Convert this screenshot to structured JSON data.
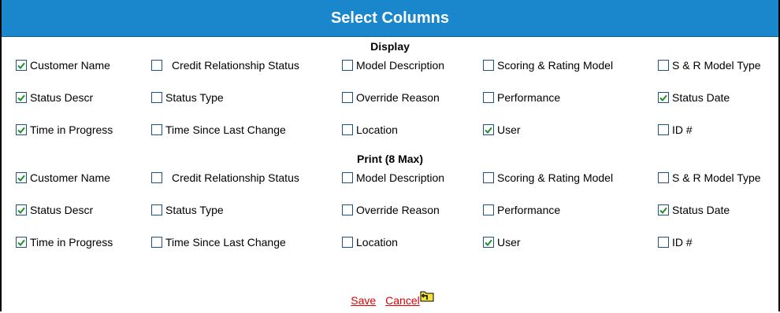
{
  "title": "Select Columns",
  "colors": {
    "title_bg": "#1a87cc",
    "link": "#e00000",
    "check": "#1f8f2a"
  },
  "display": {
    "heading": "Display",
    "rows": [
      [
        {
          "label": "Customer Name",
          "checked": true
        },
        {
          "label": "Credit Relationship Status",
          "checked": false
        },
        {
          "label": "Model Description",
          "checked": false
        },
        {
          "label": "Scoring & Rating Model",
          "checked": false
        },
        {
          "label": "S & R Model Type",
          "checked": false
        }
      ],
      [
        {
          "label": "Status Descr",
          "checked": true
        },
        {
          "label": "Status Type",
          "checked": false
        },
        {
          "label": "Override Reason",
          "checked": false
        },
        {
          "label": "Performance",
          "checked": false
        },
        {
          "label": "Status Date",
          "checked": true
        }
      ],
      [
        {
          "label": "Time in Progress",
          "checked": true
        },
        {
          "label": "Time Since Last Change",
          "checked": false
        },
        {
          "label": "Location",
          "checked": false
        },
        {
          "label": "User",
          "checked": true
        },
        {
          "label": "ID #",
          "checked": false
        }
      ]
    ]
  },
  "print": {
    "heading": "Print (8 Max)",
    "rows": [
      [
        {
          "label": "Customer Name",
          "checked": true
        },
        {
          "label": "Credit Relationship Status",
          "checked": false
        },
        {
          "label": "Model Description",
          "checked": false
        },
        {
          "label": "Scoring & Rating Model",
          "checked": false
        },
        {
          "label": "S & R Model Type",
          "checked": false
        }
      ],
      [
        {
          "label": "Status Descr",
          "checked": true
        },
        {
          "label": "Status Type",
          "checked": false
        },
        {
          "label": "Override Reason",
          "checked": false
        },
        {
          "label": "Performance",
          "checked": false
        },
        {
          "label": "Status Date",
          "checked": true
        }
      ],
      [
        {
          "label": "Time in Progress",
          "checked": true
        },
        {
          "label": "Time Since Last Change",
          "checked": false
        },
        {
          "label": "Location",
          "checked": false
        },
        {
          "label": "User",
          "checked": true
        },
        {
          "label": "ID #",
          "checked": false
        }
      ]
    ]
  },
  "footer": {
    "save_label": "Save",
    "cancel_label": "Cancel",
    "folder_icon": "folder-up-icon"
  }
}
